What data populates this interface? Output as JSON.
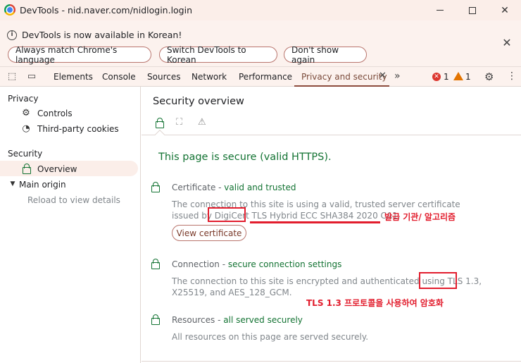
{
  "window": {
    "title": "DevTools - nid.naver.com/nidlogin.login"
  },
  "infobar": {
    "message": "DevTools is now available in Korean!",
    "buttons": [
      "Always match Chrome's language",
      "Switch DevTools to Korean",
      "Don't show again"
    ]
  },
  "toolbar": {
    "tabs": [
      "Elements",
      "Console",
      "Sources",
      "Network",
      "Performance",
      "Privacy and security"
    ],
    "error_count": "1",
    "warning_count": "1"
  },
  "sidebar": {
    "privacy_heading": "Privacy",
    "controls": "Controls",
    "third_party": "Third-party cookies",
    "security_heading": "Security",
    "overview": "Overview",
    "main_origin": "Main origin",
    "reload": "Reload to view details"
  },
  "main": {
    "title": "Security overview",
    "secure_message": "This page is secure (valid HTTPS).",
    "certificate": {
      "label": "Certificate - ",
      "status": "valid and trusted",
      "line1": "The connection to this site is using a valid, trusted server certificate",
      "line2_pre": "issued by ",
      "issuer": "DigiCert",
      "line2_post": " TLS Hybrid ECC SHA384 2020 CA1.",
      "button": "View certificate"
    },
    "connection": {
      "label": "Connection - ",
      "status": "secure connection settings",
      "line1_pre": "The connection to this site is encrypted and authenticated using ",
      "protocol": "TLS 1.3,",
      "line2": "X25519, and AES_128_GCM."
    },
    "resources": {
      "label": "Resources - ",
      "status": "all served securely",
      "line1": "All resources on this page are served securely."
    }
  },
  "annotations": {
    "issuer_note": "발급 기관/ 알고리즘",
    "tls_note": "TLS 1.3 프로토콜을 사용하여 암호화"
  },
  "colors": {
    "secure_green": "#137333",
    "annotation_red": "#e21d2d",
    "accent": "#8d4c3d"
  }
}
